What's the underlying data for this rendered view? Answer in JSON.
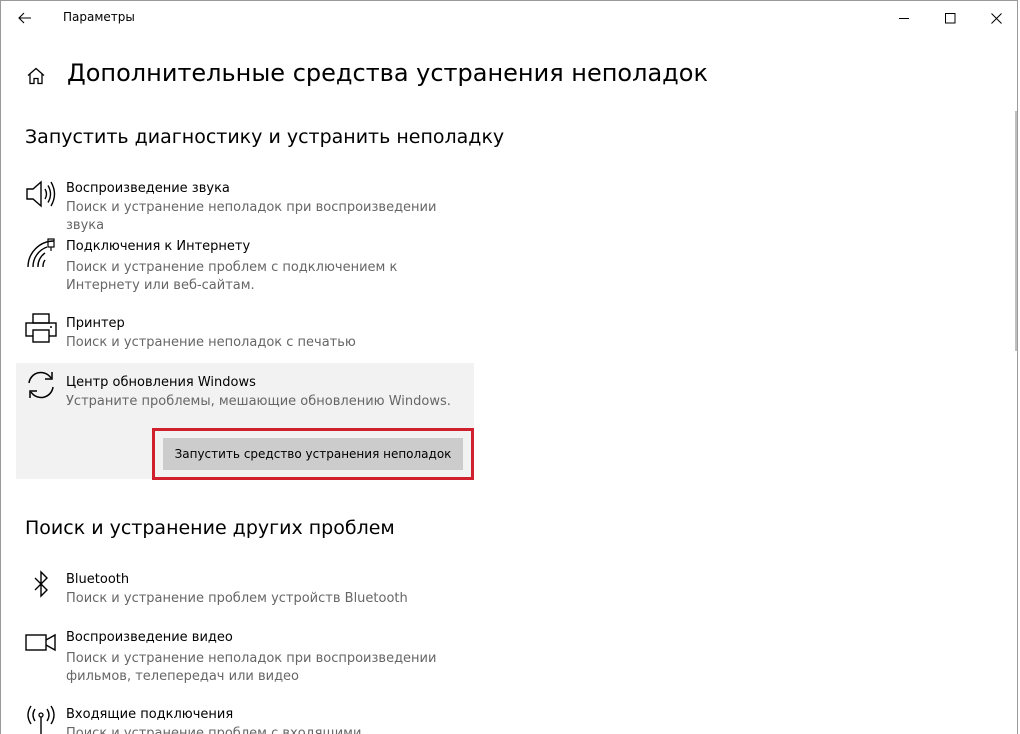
{
  "window": {
    "title": "Параметры",
    "controls": {
      "minimize": "—",
      "maximize": "☐",
      "close": "✕"
    }
  },
  "page": {
    "title": "Дополнительные средства устранения неполадок"
  },
  "section1": {
    "title": "Запустить диагностику и устранить неполадку",
    "items": [
      {
        "icon": "speaker-icon",
        "title": "Воспроизведение звука",
        "desc": "Поиск и устранение неполадок при воспроизведении звука"
      },
      {
        "icon": "wifi-icon",
        "title": "Подключения к Интернету",
        "desc": "Поиск и устранение проблем с подключением к Интернету или веб-сайтам."
      },
      {
        "icon": "printer-icon",
        "title": "Принтер",
        "desc": "Поиск и устранение неполадок с печатью"
      },
      {
        "icon": "sync-icon",
        "title": "Центр обновления Windows",
        "desc": "Устраните проблемы, мешающие обновлению Windows."
      }
    ],
    "run_button": "Запустить средство устранения неполадок"
  },
  "section2": {
    "title": "Поиск и устранение других проблем",
    "items": [
      {
        "icon": "bluetooth-icon",
        "title": "Bluetooth",
        "desc": "Поиск и устранение проблем устройств Bluetooth"
      },
      {
        "icon": "video-camera-icon",
        "title": "Воспроизведение видео",
        "desc": "Поиск и устранение неполадок при воспроизведении фильмов, телепередач или видео"
      },
      {
        "icon": "antenna-icon",
        "title": "Входящие подключения",
        "desc": "Поиск и устранение проблем с входящими подключениями"
      }
    ]
  },
  "colors": {
    "accent_frame": "#d0202e",
    "button_bg": "#cccccc",
    "selected_bg": "#f2f2f2",
    "desc_text": "#666666"
  }
}
